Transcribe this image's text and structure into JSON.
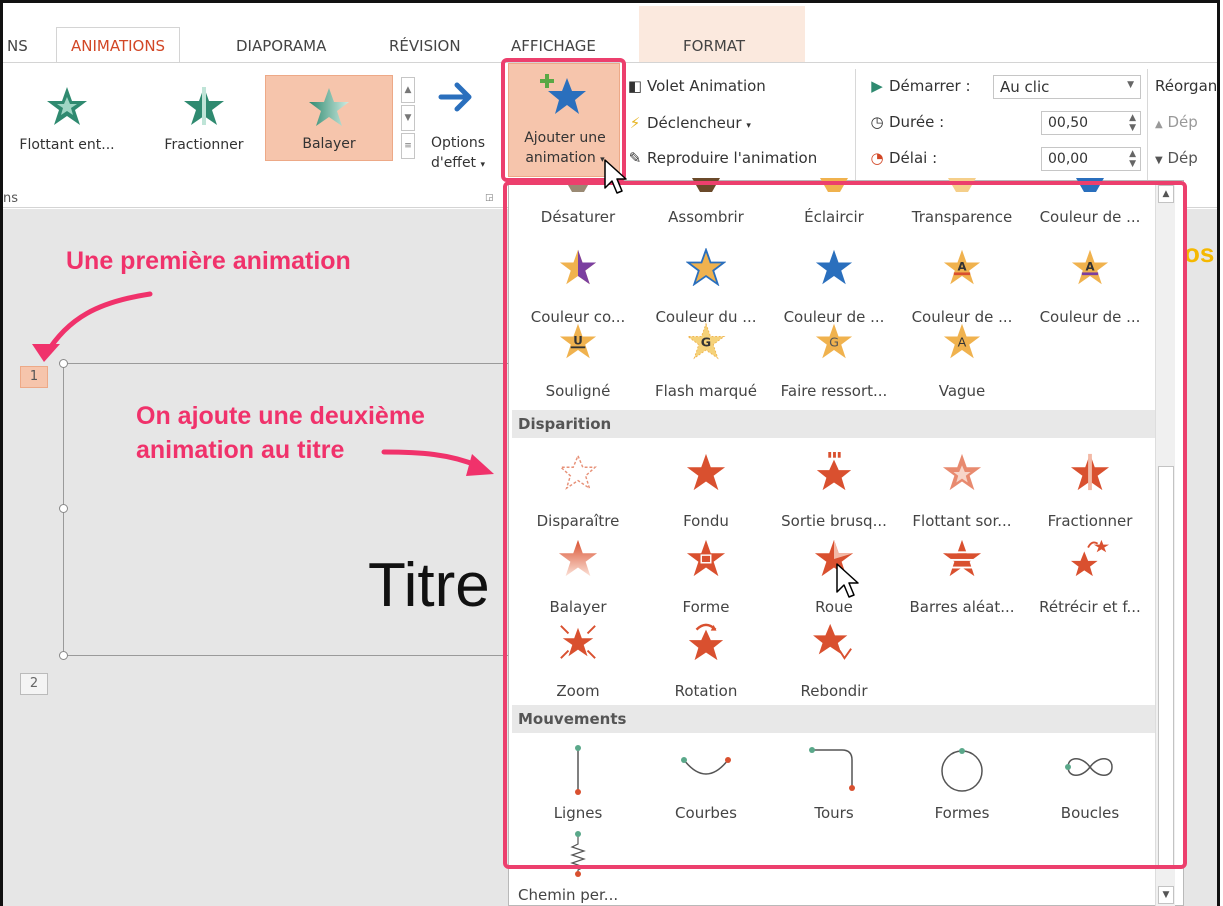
{
  "tabs": [
    {
      "label": "NS",
      "active": false
    },
    {
      "label": "ANIMATIONS",
      "active": true
    },
    {
      "label": "DIAPORAMA",
      "active": false
    },
    {
      "label": "RÉVISION",
      "active": false
    },
    {
      "label": "AFFICHAGE",
      "active": false
    },
    {
      "label": "FORMAT",
      "active": false
    }
  ],
  "ribbon": {
    "gallery": [
      "Flottant ent...",
      "Fractionner",
      "Balayer"
    ],
    "gallery_selected": "Balayer",
    "group_label": "ns",
    "effect_options": [
      "Options",
      "d'effet"
    ],
    "add_animation": [
      "Ajouter une",
      "animation"
    ],
    "animation_pane": "Volet Animation",
    "trigger": "Déclencheur",
    "painter": "Reproduire l'animation",
    "start_label": "Démarrer :",
    "start_value": "Au clic",
    "duration_label": "Durée :",
    "duration_value": "00,50",
    "delay_label": "Délai :",
    "delay_value": "00,00",
    "reorder_label": "Réorgan",
    "move_earlier": "Dép",
    "move_later": "Dép"
  },
  "slide": {
    "thumb1": "1",
    "thumb2": "2",
    "title": "Titre",
    "side_letters": "os"
  },
  "annotations": {
    "first": "Une première animation",
    "second_line1": "On ajoute une deuxième",
    "second_line2": "animation au titre"
  },
  "dropdown": {
    "emphasis_row1": [
      "Désaturer",
      "Assombrir",
      "Éclaircir",
      "Transparence",
      "Couleur de ..."
    ],
    "emphasis_row2": [
      "Couleur co...",
      "Couleur du ...",
      "Couleur de ...",
      "Couleur de ...",
      "Couleur de ..."
    ],
    "emphasis_row3": [
      "Souligné",
      "Flash marqué",
      "Faire ressort...",
      "Vague"
    ],
    "exit_header": "Disparition",
    "exit_row1": [
      "Disparaître",
      "Fondu",
      "Sortie brusq...",
      "Flottant sor...",
      "Fractionner"
    ],
    "exit_row2": [
      "Balayer",
      "Forme",
      "Roue",
      "Barres aléat...",
      "Rétrécir et f..."
    ],
    "exit_row3": [
      "Zoom",
      "Rotation",
      "Rebondir"
    ],
    "motion_header": "Mouvements",
    "motion_row1": [
      "Lignes",
      "Courbes",
      "Tours",
      "Formes",
      "Boucles"
    ],
    "motion_row2": [
      "Chemin per..."
    ]
  },
  "colors": {
    "accent_tab": "#d24726",
    "highlight_pink": "#ec3f6d",
    "exit_star": "#d9502f",
    "emphasis_star": "#f0b24e",
    "entrance_star": "#2f8a70"
  }
}
